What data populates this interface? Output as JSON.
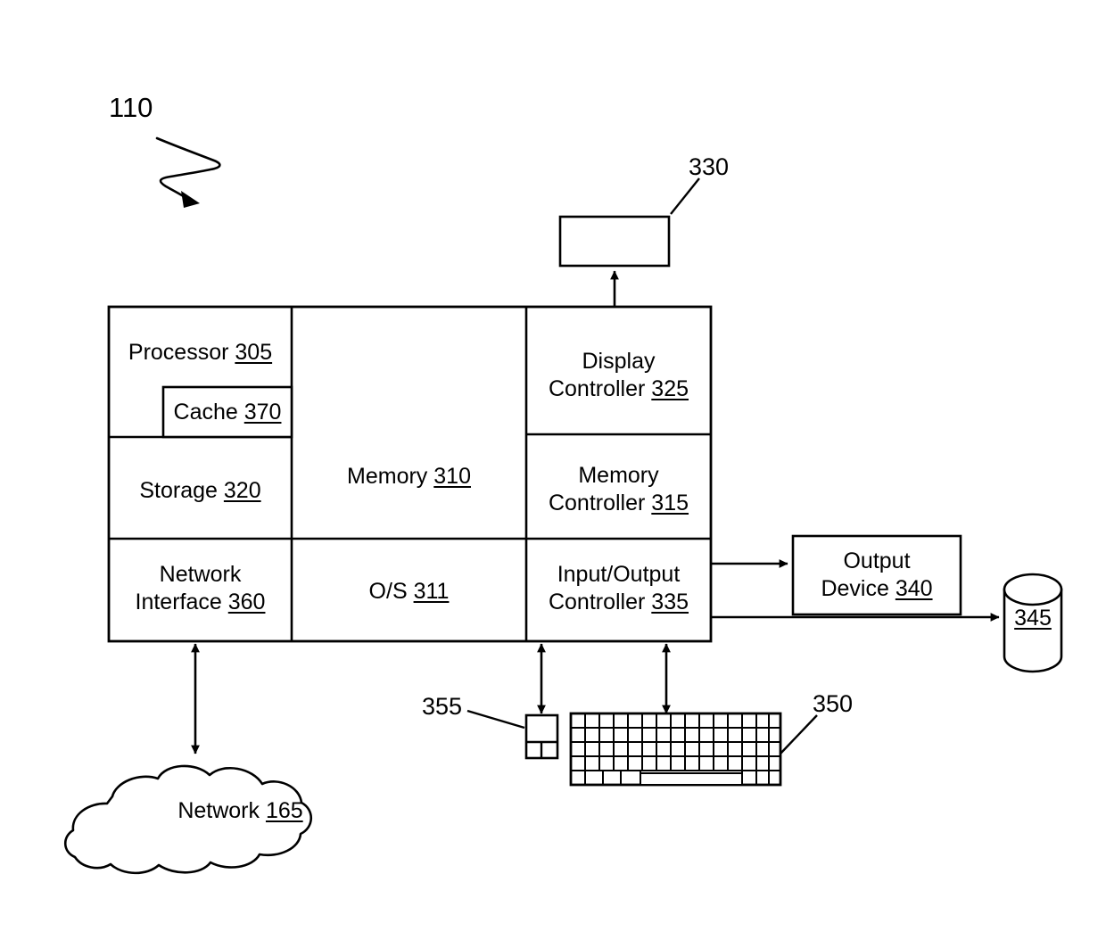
{
  "figure": {
    "top_reference": "110",
    "description": "Computing device block diagram"
  },
  "system_box": {
    "cells": [
      {
        "name": "processor",
        "label": "Processor",
        "ref": "305"
      },
      {
        "name": "cache",
        "label": "Cache",
        "ref": "370"
      },
      {
        "name": "storage",
        "label": "Storage",
        "ref": "320"
      },
      {
        "name": "network-interface",
        "label": "Network\nInterface",
        "ref": "360"
      },
      {
        "name": "memory",
        "label": "Memory",
        "ref": "310"
      },
      {
        "name": "operating-system",
        "label": "O/S",
        "ref": "311"
      },
      {
        "name": "display-controller",
        "label": "Display\nController",
        "ref": "325"
      },
      {
        "name": "memory-controller",
        "label": "Memory\nController",
        "ref": "315"
      },
      {
        "name": "io-controller",
        "label": "Input/Output\nController",
        "ref": "335"
      }
    ]
  },
  "peripherals": {
    "display": {
      "label": "",
      "ref": "330"
    },
    "output_device": {
      "label": "Output\nDevice",
      "ref": "340"
    },
    "database": {
      "label": "",
      "ref": "345"
    },
    "mouse": {
      "label": "",
      "ref": "355"
    },
    "keyboard": {
      "label": "",
      "ref": "350"
    },
    "network_cloud": {
      "label": "Network",
      "ref": "165"
    }
  },
  "connections": [
    {
      "name": "display-controller-to-display",
      "type": "arrow-up"
    },
    {
      "name": "io-controller-to-output-device",
      "type": "arrow-right"
    },
    {
      "name": "io-controller-to-database",
      "type": "arrow-right"
    },
    {
      "name": "io-controller-to-mouse",
      "type": "arrow-bidirectional"
    },
    {
      "name": "io-controller-to-keyboard",
      "type": "arrow-bidirectional"
    },
    {
      "name": "network-interface-to-network",
      "type": "arrow-bidirectional"
    }
  ],
  "colors": {
    "stroke": "#000000",
    "background": "#ffffff",
    "text": "#000000"
  }
}
